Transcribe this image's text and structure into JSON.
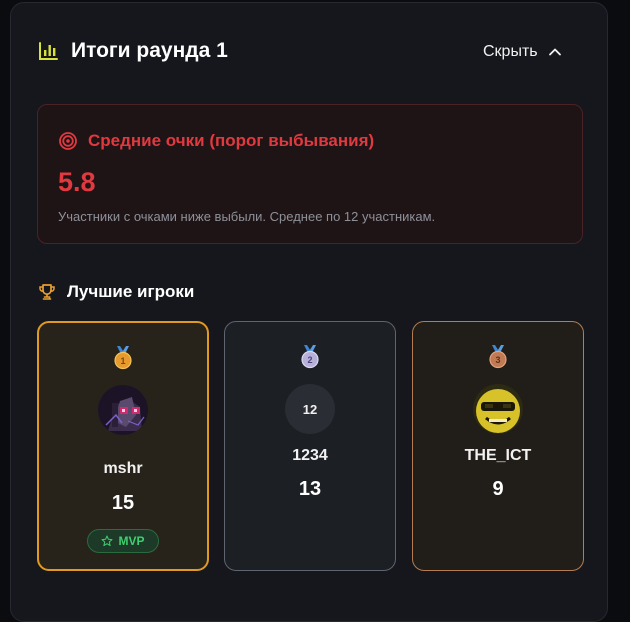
{
  "header": {
    "title": "Итоги раунда 1",
    "hide_label": "Скрыть",
    "icon": "bar-chart-icon"
  },
  "threshold": {
    "title": "Средние очки (порог выбывания)",
    "value": "5.8",
    "description": "Участники с очками ниже выбыли. Среднее по 12 участникам.",
    "icon": "target-icon",
    "color": "#e0393f"
  },
  "best": {
    "title": "Лучшие игроки",
    "icon": "trophy-icon",
    "players": [
      {
        "rank": "1",
        "name": "mshr",
        "score": "15",
        "badge": "MVP",
        "medal_color": "#e79a2d",
        "avatar": "pixel-art-avatar"
      },
      {
        "rank": "2",
        "name": "1234",
        "score": "13",
        "avatar_text": "12",
        "medal_color": "#b7b0d9"
      },
      {
        "rank": "3",
        "name": "THE_ICT",
        "score": "9",
        "medal_color": "#c27a55",
        "avatar": "yellow-face-avatar"
      }
    ]
  },
  "colors": {
    "gold": "#e09a22",
    "silver": "#5e6470",
    "bronze": "#b47c50",
    "mvp_green": "#3fcf6f"
  }
}
